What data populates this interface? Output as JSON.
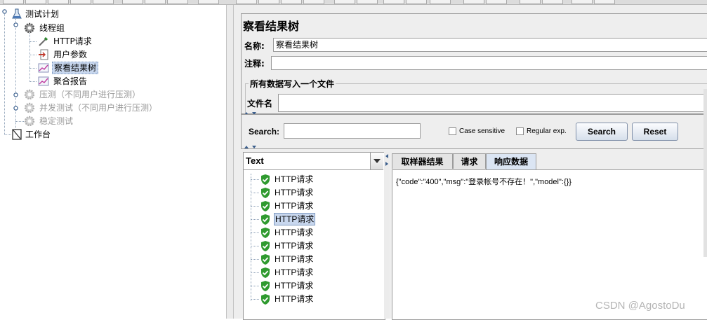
{
  "tree": {
    "items": [
      {
        "label": "测试计划",
        "icon": "flask-icon"
      },
      {
        "label": "线程组",
        "icon": "gear-icon"
      },
      {
        "label": "HTTP请求",
        "icon": "pipette-icon"
      },
      {
        "label": "用户参数",
        "icon": "document-icon"
      },
      {
        "label": "察看结果树",
        "icon": "chart-icon"
      },
      {
        "label": "聚合报告",
        "icon": "chart-icon"
      },
      {
        "label": "压测（不同用户进行压测）",
        "icon": "gear-icon"
      },
      {
        "label": "并发测试（不同用户进行压测）",
        "icon": "gear-icon"
      },
      {
        "label": "稳定测试",
        "icon": "gear-icon"
      },
      {
        "label": "工作台",
        "icon": "workbench-icon"
      }
    ]
  },
  "panel": {
    "title": "察看结果树",
    "name_label": "名称:",
    "name_value": "察看结果树",
    "comment_label": "注释:",
    "comment_value": "",
    "file_group_title": "所有数据写入一个文件",
    "filename_label": "文件名",
    "filename_value": ""
  },
  "search": {
    "label": "Search:",
    "value": "",
    "case_sensitive_label": "Case sensitive",
    "regex_label": "Regular exp.",
    "search_button": "Search",
    "reset_button": "Reset"
  },
  "results": {
    "renderer": "Text",
    "items": [
      "HTTP请求",
      "HTTP请求",
      "HTTP请求",
      "HTTP请求",
      "HTTP请求",
      "HTTP请求",
      "HTTP请求",
      "HTTP请求",
      "HTTP请求",
      "HTTP请求"
    ]
  },
  "tabs": [
    "取样器结果",
    "请求",
    "响应数据"
  ],
  "response": {
    "text": "{\"code\":\"400\",\"msg\":\"登录帐号不存在！\",\"model\":{}}"
  },
  "watermark": "CSDN @AgostoDu",
  "colors": {
    "selection": "#c8d7ee",
    "success_shield": "#2f9a2f",
    "panel_bg": "#eeeeee"
  }
}
